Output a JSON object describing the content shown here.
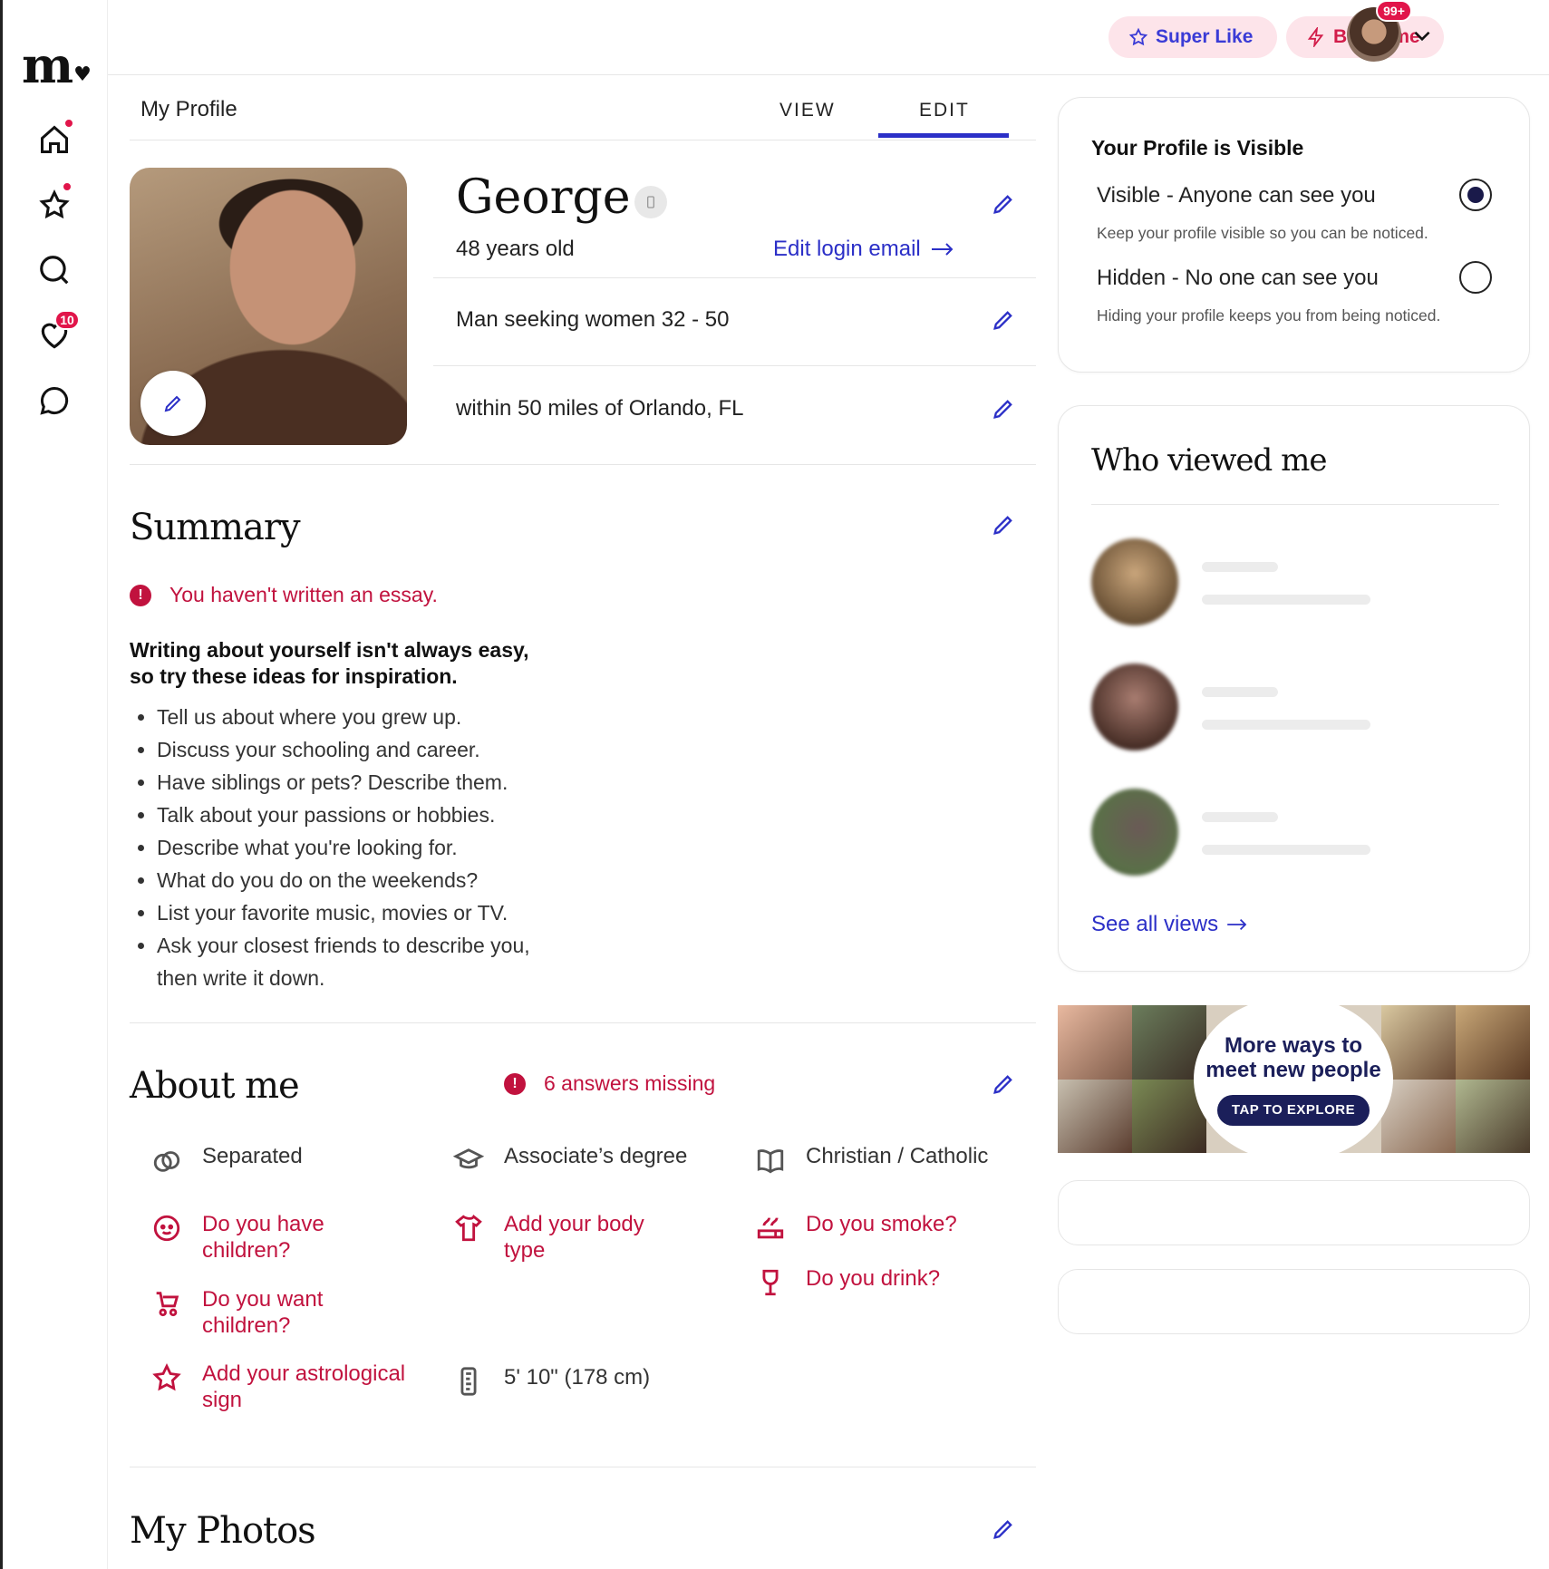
{
  "brand": {
    "logo": "m",
    "accent": "#2b2fc7",
    "alert": "#c1123e"
  },
  "rail": {
    "items": [
      {
        "name": "home",
        "dot": true
      },
      {
        "name": "favorites",
        "dot": true
      },
      {
        "name": "search"
      },
      {
        "name": "likes",
        "count": "10"
      },
      {
        "name": "messages"
      }
    ]
  },
  "topbar": {
    "super_like": "Super Like",
    "boost": "Boost me",
    "notif_badge": "99+"
  },
  "profile": {
    "header_title": "My Profile",
    "tab_view": "VIEW",
    "tab_edit": "EDIT",
    "name": "George",
    "age": "48 years old",
    "edit_email": "Edit login email",
    "seeking": "Man seeking women 32 - 50",
    "location": "within 50 miles of Orlando, FL"
  },
  "summary": {
    "title": "Summary",
    "warning": "You haven't written an essay.",
    "tips_heading_1": "Writing about yourself isn't always easy,",
    "tips_heading_2": "so try these ideas for inspiration.",
    "tips": [
      "Tell us about where you grew up.",
      "Discuss your schooling and career.",
      "Have siblings or pets? Describe them.",
      "Talk about your passions or hobbies.",
      "Describe what you're looking for.",
      "What do you do on the weekends?",
      "List your favorite music, movies or TV.",
      "Ask your closest friends to describe you, then write it down."
    ]
  },
  "about": {
    "title": "About me",
    "missing": "6 answers missing",
    "items": {
      "relationship": "Separated",
      "children": "Do you have children?",
      "want_children": "Do you want children?",
      "astro": "Add your astrological sign",
      "education": "Associate’s degree",
      "body": "Add your body type",
      "height": "5' 10\" (178 cm)",
      "religion": "Christian / Catholic",
      "smoke": "Do you smoke?",
      "drink": "Do you drink?"
    }
  },
  "photos": {
    "title": "My Photos"
  },
  "visibility": {
    "title": "Your Profile is Visible",
    "visible_label": "Visible - Anyone can see you",
    "visible_sub": "Keep your profile visible so you can be noticed.",
    "hidden_label": "Hidden - No one can see you",
    "hidden_sub": "Hiding your profile keeps you from being noticed."
  },
  "viewed": {
    "title": "Who viewed me",
    "see_all": "See all views"
  },
  "promo": {
    "text_1": "More ways to",
    "text_2": "meet new people",
    "button": "TAP TO EXPLORE"
  }
}
